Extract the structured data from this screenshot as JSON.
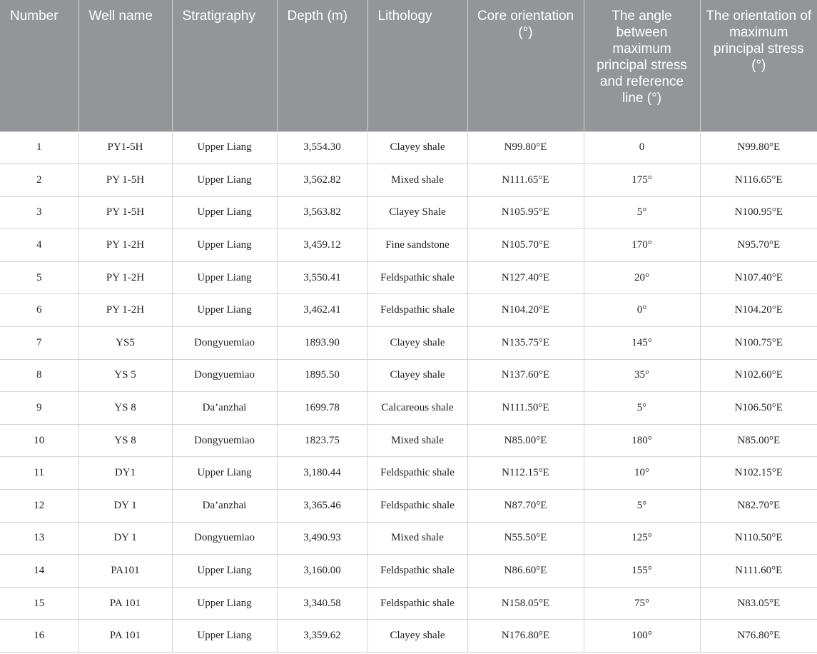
{
  "table": {
    "headers": [
      "Number",
      "Well name",
      "Stratigraphy",
      "Depth (m)",
      "Lithology",
      "Core orientation (°)",
      "The angle between maximum principal stress and reference line (°)",
      "The orientation of maximum principal stress (°)"
    ],
    "rows": [
      [
        "1",
        "PY1-5H",
        "Upper Liang",
        "3,554.30",
        "Clayey shale",
        "N99.80°E",
        "0",
        "N99.80°E"
      ],
      [
        "2",
        "PY 1-5H",
        "Upper Liang",
        "3,562.82",
        "Mixed shale",
        "N111.65°E",
        "175°",
        "N116.65°E"
      ],
      [
        "3",
        "PY 1-5H",
        "Upper Liang",
        "3,563.82",
        "Clayey Shale",
        "N105.95°E",
        "5°",
        "N100.95°E"
      ],
      [
        "4",
        "PY 1-2H",
        "Upper Liang",
        "3,459.12",
        "Fine sandstone",
        "N105.70°E",
        "170°",
        "N95.70°E"
      ],
      [
        "5",
        "PY 1-2H",
        "Upper Liang",
        "3,550.41",
        "Feldspathic shale",
        "N127.40°E",
        "20°",
        "N107.40°E"
      ],
      [
        "6",
        "PY 1-2H",
        "Upper Liang",
        "3,462.41",
        "Feldspathic shale",
        "N104.20°E",
        "0°",
        "N104.20°E"
      ],
      [
        "7",
        "YS5",
        "Dongyuemiao",
        "1893.90",
        "Clayey shale",
        "N135.75°E",
        "145°",
        "N100.75°E"
      ],
      [
        "8",
        "YS 5",
        "Dongyuemiao",
        "1895.50",
        "Clayey shale",
        "N137.60°E",
        "35°",
        "N102.60°E"
      ],
      [
        "9",
        "YS 8",
        "Da’anzhai",
        "1699.78",
        "Calcareous shale",
        "N111.50°E",
        "5°",
        "N106.50°E"
      ],
      [
        "10",
        "YS 8",
        "Dongyuemiao",
        "1823.75",
        "Mixed shale",
        "N85.00°E",
        "180°",
        "N85.00°E"
      ],
      [
        "11",
        "DY1",
        "Upper Liang",
        "3,180.44",
        "Feldspathic shale",
        "N112.15°E",
        "10°",
        "N102.15°E"
      ],
      [
        "12",
        "DY 1",
        "Da’anzhai",
        "3,365.46",
        "Feldspathic shale",
        "N87.70°E",
        "5°",
        "N82.70°E"
      ],
      [
        "13",
        "DY 1",
        "Dongyuemiao",
        "3,490.93",
        "Mixed shale",
        "N55.50°E",
        "125°",
        "N110.50°E"
      ],
      [
        "14",
        "PA101",
        "Upper Liang",
        "3,160.00",
        "Feldspathic shale",
        "N86.60°E",
        "155°",
        "N111.60°E"
      ],
      [
        "15",
        "PA 101",
        "Upper Liang",
        "3,340.58",
        "Feldspathic shale",
        "N158.05°E",
        "75°",
        "N83.05°E"
      ],
      [
        "16",
        "PA 101",
        "Upper Liang",
        "3,359.62",
        "Clayey shale",
        "N176.80°E",
        "100°",
        "N76.80°E"
      ]
    ]
  },
  "colors": {
    "header_background": "#939598",
    "header_text": "#ffffff",
    "grid_line": "#d4d4d4"
  }
}
